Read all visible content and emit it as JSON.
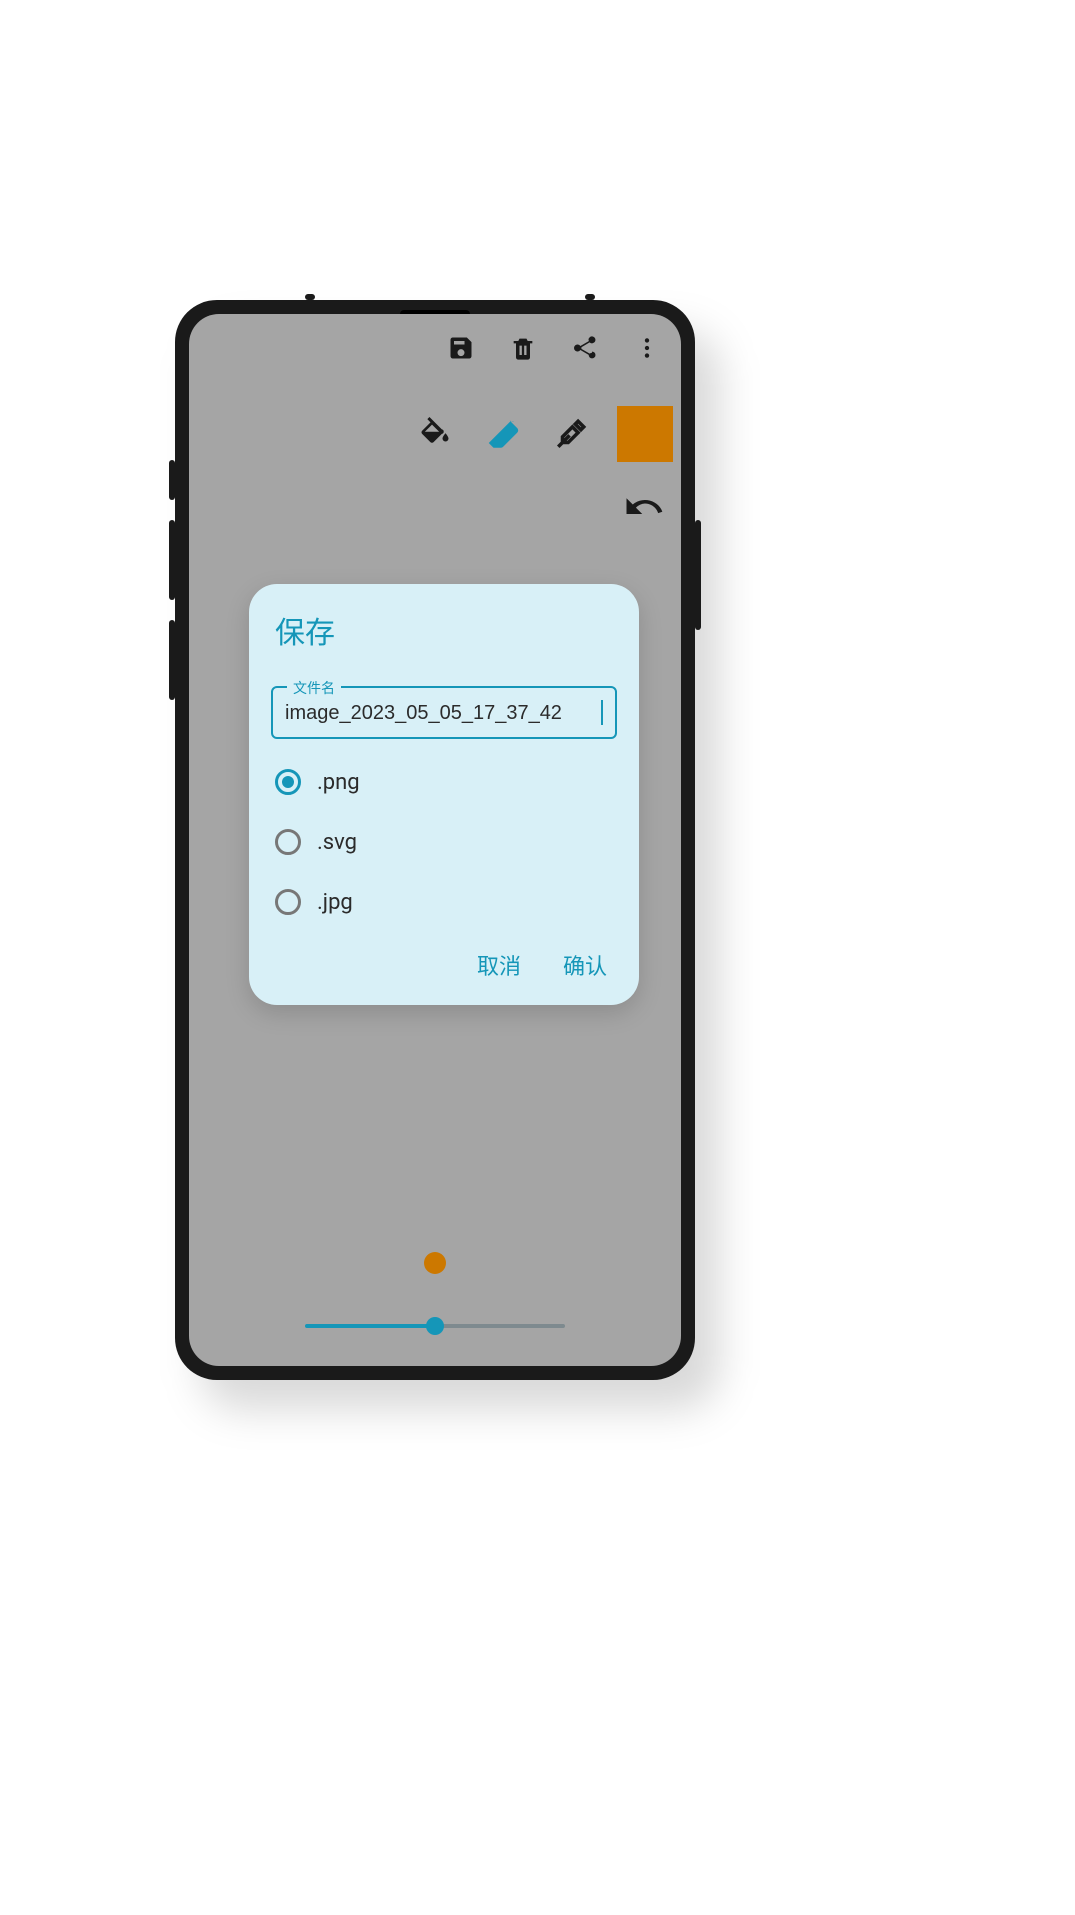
{
  "app_bar": {
    "save_icon": "save-icon",
    "delete_icon": "delete-icon",
    "share_icon": "share-icon",
    "menu_icon": "menu-dots-icon"
  },
  "tools": {
    "fill_icon": "fill-bucket-icon",
    "eraser_icon": "eraser-icon",
    "eyedropper_icon": "eyedropper-icon",
    "color_hex": "#cc7800",
    "undo_icon": "undo-icon"
  },
  "dialog": {
    "title": "保存",
    "filename_label": "文件名",
    "filename_value": "image_2023_05_05_17_37_42",
    "formats": [
      {
        "label": ".png",
        "selected": true
      },
      {
        "label": ".svg",
        "selected": false
      },
      {
        "label": ".jpg",
        "selected": false
      }
    ],
    "cancel_label": "取消",
    "confirm_label": "确认"
  },
  "brush": {
    "dot_color": "#cc7800",
    "slider_percent": 50
  }
}
